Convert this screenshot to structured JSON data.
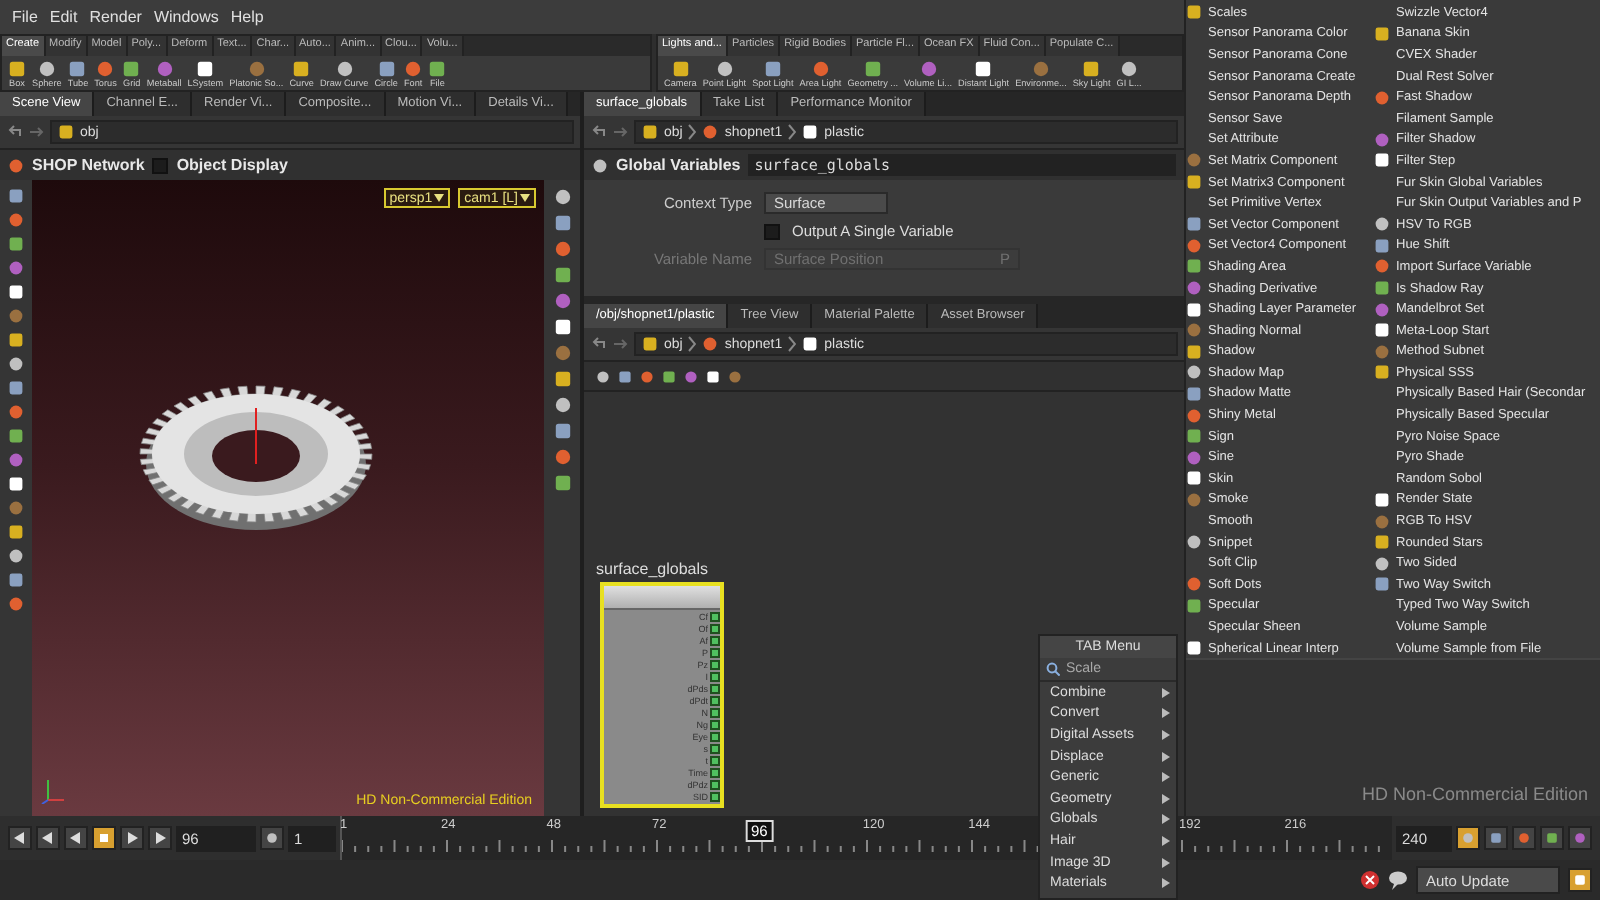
{
  "menu_bar": [
    "File",
    "Edit",
    "Render",
    "Windows",
    "Help"
  ],
  "shelf_left": {
    "tabs": [
      {
        "label": "Create",
        "selected": true
      },
      {
        "label": "Modify",
        "selected": false
      },
      {
        "label": "Model",
        "selected": false
      },
      {
        "label": "Poly...",
        "selected": false
      },
      {
        "label": "Deform",
        "selected": false
      },
      {
        "label": "Text...",
        "selected": false
      },
      {
        "label": "Char...",
        "selected": false
      },
      {
        "label": "Auto...",
        "selected": false
      },
      {
        "label": "Anim...",
        "selected": false
      },
      {
        "label": "Clou...",
        "selected": false
      },
      {
        "label": "Volu...",
        "selected": false
      }
    ],
    "tools": [
      "Box",
      "Sphere",
      "Tube",
      "Torus",
      "Grid",
      "Metaball",
      "LSystem",
      "Platonic So...",
      "Curve",
      "Draw Curve",
      "Circle",
      "Font",
      "File"
    ]
  },
  "shelf_right": {
    "tabs": [
      {
        "label": "Lights and...",
        "selected": true
      },
      {
        "label": "Particles",
        "selected": false
      },
      {
        "label": "Rigid Bodies",
        "selected": false
      },
      {
        "label": "Particle Fl...",
        "selected": false
      },
      {
        "label": "Ocean FX",
        "selected": false
      },
      {
        "label": "Fluid Con...",
        "selected": false
      },
      {
        "label": "Populate C...",
        "selected": false
      }
    ],
    "tools": [
      "Camera",
      "Point Light",
      "Spot Light",
      "Area Light",
      "Geometry ...",
      "Volume Li...",
      "Distant Light",
      "Environme...",
      "Sky Light",
      "GI L..."
    ]
  },
  "scene_view": {
    "tabs": [
      {
        "label": "Scene View",
        "selected": true
      },
      {
        "label": "Channel E...",
        "selected": false
      },
      {
        "label": "Render Vi...",
        "selected": false
      },
      {
        "label": "Composite...",
        "selected": false
      },
      {
        "label": "Motion Vi...",
        "selected": false
      },
      {
        "label": "Details Vi...",
        "selected": false
      }
    ],
    "path": [
      "obj"
    ],
    "network_label": "SHOP Network",
    "object_display": {
      "label": "Object Display",
      "checked": false
    },
    "camera_menus": [
      "persp1",
      "cam1 [L]"
    ],
    "edition_label": "HD Non-Commercial Edition"
  },
  "parameters": {
    "tabs": [
      {
        "label": "surface_globals",
        "selected": true
      },
      {
        "label": "Take List",
        "selected": false
      },
      {
        "label": "Performance Monitor",
        "selected": false
      }
    ],
    "path": [
      "obj",
      "shopnet1",
      "plastic"
    ],
    "node_type": "Global Variables",
    "node_name": "surface_globals",
    "context_type": {
      "label": "Context Type",
      "value": "Surface"
    },
    "single_variable": {
      "label": "Output A Single Variable",
      "checked": false
    },
    "variable_name": {
      "label": "Variable Name",
      "value": "Surface Position",
      "code": "P",
      "disabled": true
    }
  },
  "network": {
    "tabs": [
      {
        "label": "/obj/shopnet1/plastic",
        "selected": true
      },
      {
        "label": "Tree View",
        "selected": false
      },
      {
        "label": "Material Palette",
        "selected": false
      },
      {
        "label": "Asset Browser",
        "selected": false
      }
    ],
    "path": [
      "obj",
      "shopnet1",
      "plastic"
    ],
    "node": {
      "name": "surface_globals",
      "outputs": [
        "Cf",
        "Of",
        "Af",
        "P",
        "Pz",
        "I",
        "dPds",
        "dPdt",
        "N",
        "Ng",
        "Eye",
        "s",
        "t",
        "Time",
        "dPdz",
        "SID"
      ]
    }
  },
  "tab_menu": {
    "title": "TAB Menu",
    "search": "Scale",
    "items": [
      "Combine",
      "Convert",
      "Digital Assets",
      "Displace",
      "Generic",
      "Geometry",
      "Globals",
      "Hair",
      "Image 3D",
      "Materials"
    ]
  },
  "node_list": [
    {
      "label": "Scales",
      "icon": true
    },
    {
      "label": "Sensor Panorama Color",
      "icon": false
    },
    {
      "label": "Sensor Panorama Cone",
      "icon": false
    },
    {
      "label": "Sensor Panorama Create",
      "icon": false
    },
    {
      "label": "Sensor Panorama Depth",
      "icon": false
    },
    {
      "label": "Sensor Save",
      "icon": false
    },
    {
      "label": "Set Attribute",
      "icon": false
    },
    {
      "label": "Set Matrix Component",
      "icon": true
    },
    {
      "label": "Set Matrix3 Component",
      "icon": true
    },
    {
      "label": "Set Primitive Vertex",
      "icon": false
    },
    {
      "label": "Set Vector Component",
      "icon": true
    },
    {
      "label": "Set Vector4 Component",
      "icon": true
    },
    {
      "label": "Shading Area",
      "icon": true
    },
    {
      "label": "Shading Derivative",
      "icon": true
    },
    {
      "label": "Shading Layer Parameter",
      "icon": true
    },
    {
      "label": "Shading Normal",
      "icon": true
    },
    {
      "label": "Shadow",
      "icon": true
    },
    {
      "label": "Shadow Map",
      "icon": true
    },
    {
      "label": "Shadow Matte",
      "icon": true
    },
    {
      "label": "Shiny Metal",
      "icon": true
    },
    {
      "label": "Sign",
      "icon": true
    },
    {
      "label": "Sine",
      "icon": true
    },
    {
      "label": "Skin",
      "icon": true
    },
    {
      "label": "Smoke",
      "icon": true
    },
    {
      "label": "Smooth",
      "icon": false
    },
    {
      "label": "Snippet",
      "icon": true
    },
    {
      "label": "Soft Clip",
      "icon": false
    },
    {
      "label": "Soft Dots",
      "icon": true
    },
    {
      "label": "Specular",
      "icon": true
    },
    {
      "label": "Specular Sheen",
      "icon": false
    },
    {
      "label": "Spherical Linear Interp",
      "icon": true
    },
    {
      "label": "Swizzle Vector4",
      "icon": false
    },
    {
      "label": "Banana Skin",
      "icon": true
    },
    {
      "label": "CVEX Shader",
      "icon": false
    },
    {
      "label": "Dual Rest Solver",
      "icon": false
    },
    {
      "label": "Fast Shadow",
      "icon": true
    },
    {
      "label": "Filament Sample",
      "icon": false
    },
    {
      "label": "Filter Shadow",
      "icon": true
    },
    {
      "label": "Filter Step",
      "icon": true
    },
    {
      "label": "Fur Skin Global Variables",
      "icon": false
    },
    {
      "label": "Fur Skin Output Variables and P",
      "icon": false
    },
    {
      "label": "HSV To RGB",
      "icon": true
    },
    {
      "label": "Hue Shift",
      "icon": true
    },
    {
      "label": "Import Surface Variable",
      "icon": true
    },
    {
      "label": "Is Shadow Ray",
      "icon": true
    },
    {
      "label": "Mandelbrot Set",
      "icon": true
    },
    {
      "label": "Meta-Loop Start",
      "icon": true
    },
    {
      "label": "Method Subnet",
      "icon": true
    },
    {
      "label": "Physical SSS",
      "icon": true
    },
    {
      "label": "Physically Based Hair (Secondar",
      "icon": false
    },
    {
      "label": "Physically Based Specular",
      "icon": false
    },
    {
      "label": "Pyro Noise Space",
      "icon": false
    },
    {
      "label": "Pyro Shade",
      "icon": false
    },
    {
      "label": "Random Sobol",
      "icon": false
    },
    {
      "label": "Render State",
      "icon": true
    },
    {
      "label": "RGB To HSV",
      "icon": true
    },
    {
      "label": "Rounded Stars",
      "icon": true
    },
    {
      "label": "Two Sided",
      "icon": true
    },
    {
      "label": "Two Way Switch",
      "icon": true
    },
    {
      "label": "Typed Two Way Switch",
      "icon": false
    },
    {
      "label": "Volume Sample",
      "icon": false
    },
    {
      "label": "Volume Sample from File",
      "icon": false
    }
  ],
  "right_panel_label": "HD Non-Commercial Edition",
  "timeline": {
    "current_frame": "96",
    "step": "1",
    "ticks": [
      "1",
      "24",
      "48",
      "72",
      "120",
      "144",
      "192",
      "216"
    ],
    "playhead": "96",
    "end_frame": "240"
  },
  "status_bar": {
    "update_mode": "Auto Update"
  }
}
